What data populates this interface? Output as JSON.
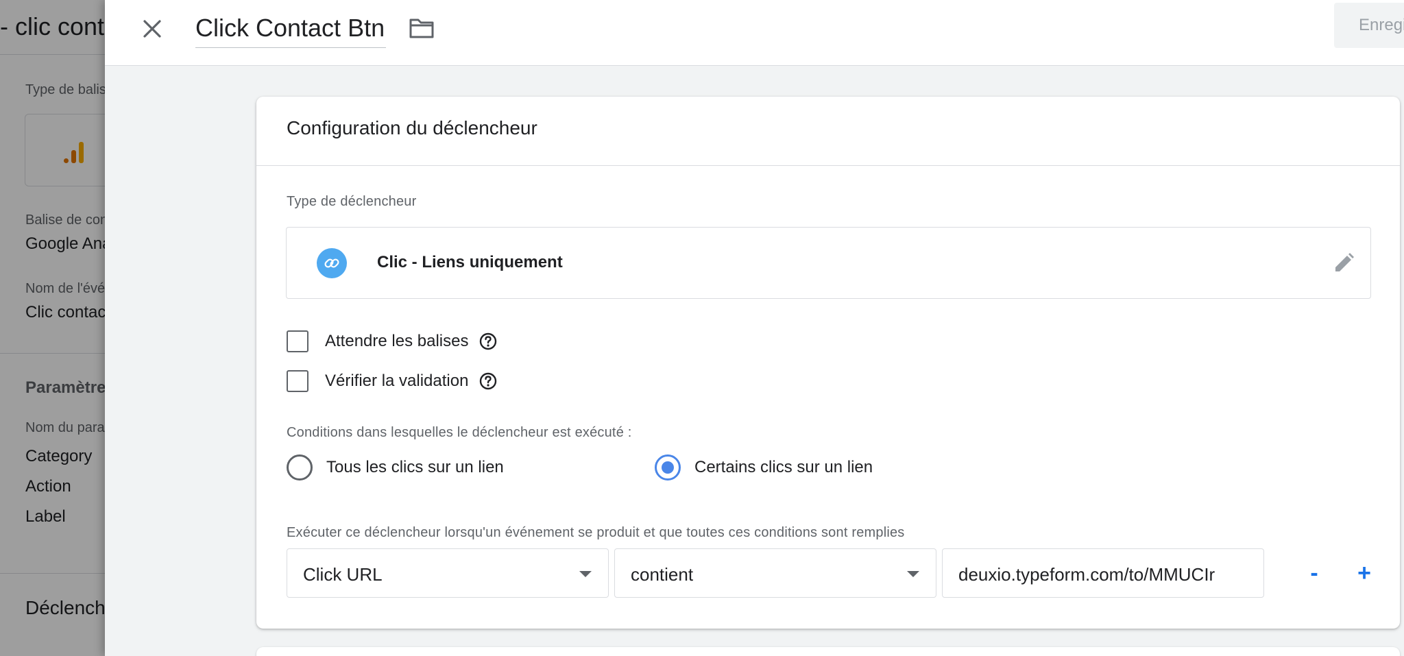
{
  "background": {
    "title": "- clic contact",
    "tag_type_label": "Type de balise",
    "config_tag_label": "Balise de configuration",
    "config_tag_value": "Google Analytics",
    "event_name_label": "Nom de l'événement",
    "event_name_value": "Clic contact",
    "params_section": "Paramètres",
    "param_name_label": "Nom du paramètre",
    "params": [
      "Category",
      "Action",
      "Label"
    ],
    "triggers_section": "Déclencheurs"
  },
  "panel": {
    "trigger_name": "Click Contact Btn",
    "save_label": "Enregistrer",
    "icons": {
      "close": "close-icon",
      "folder": "folder-icon"
    }
  },
  "card": {
    "title": "Configuration du déclencheur",
    "trigger_type_label": "Type de déclencheur",
    "trigger_type_value": "Clic - Liens uniquement",
    "checkboxes": [
      {
        "label": "Attendre les balises",
        "checked": false
      },
      {
        "label": "Vérifier la validation",
        "checked": false
      }
    ],
    "conditions_label": "Conditions dans lesquelles le déclencheur est exécuté :",
    "radios": [
      {
        "label": "Tous les clics sur un lien",
        "checked": false
      },
      {
        "label": "Certains clics sur un lien",
        "checked": true
      }
    ],
    "filter_label": "Exécuter ce déclencheur lorsqu'un événement se produit et que toutes ces conditions sont remplies",
    "filter": {
      "variable": "Click URL",
      "operator": "contient",
      "value": "deuxio.typeform.com/to/MMUCIr"
    },
    "remove_label": "-",
    "add_label": "+"
  },
  "colors": {
    "accent": "#4a86e8",
    "link_icon_bg": "#4fa9f0",
    "action_blue": "#1a73e8"
  }
}
